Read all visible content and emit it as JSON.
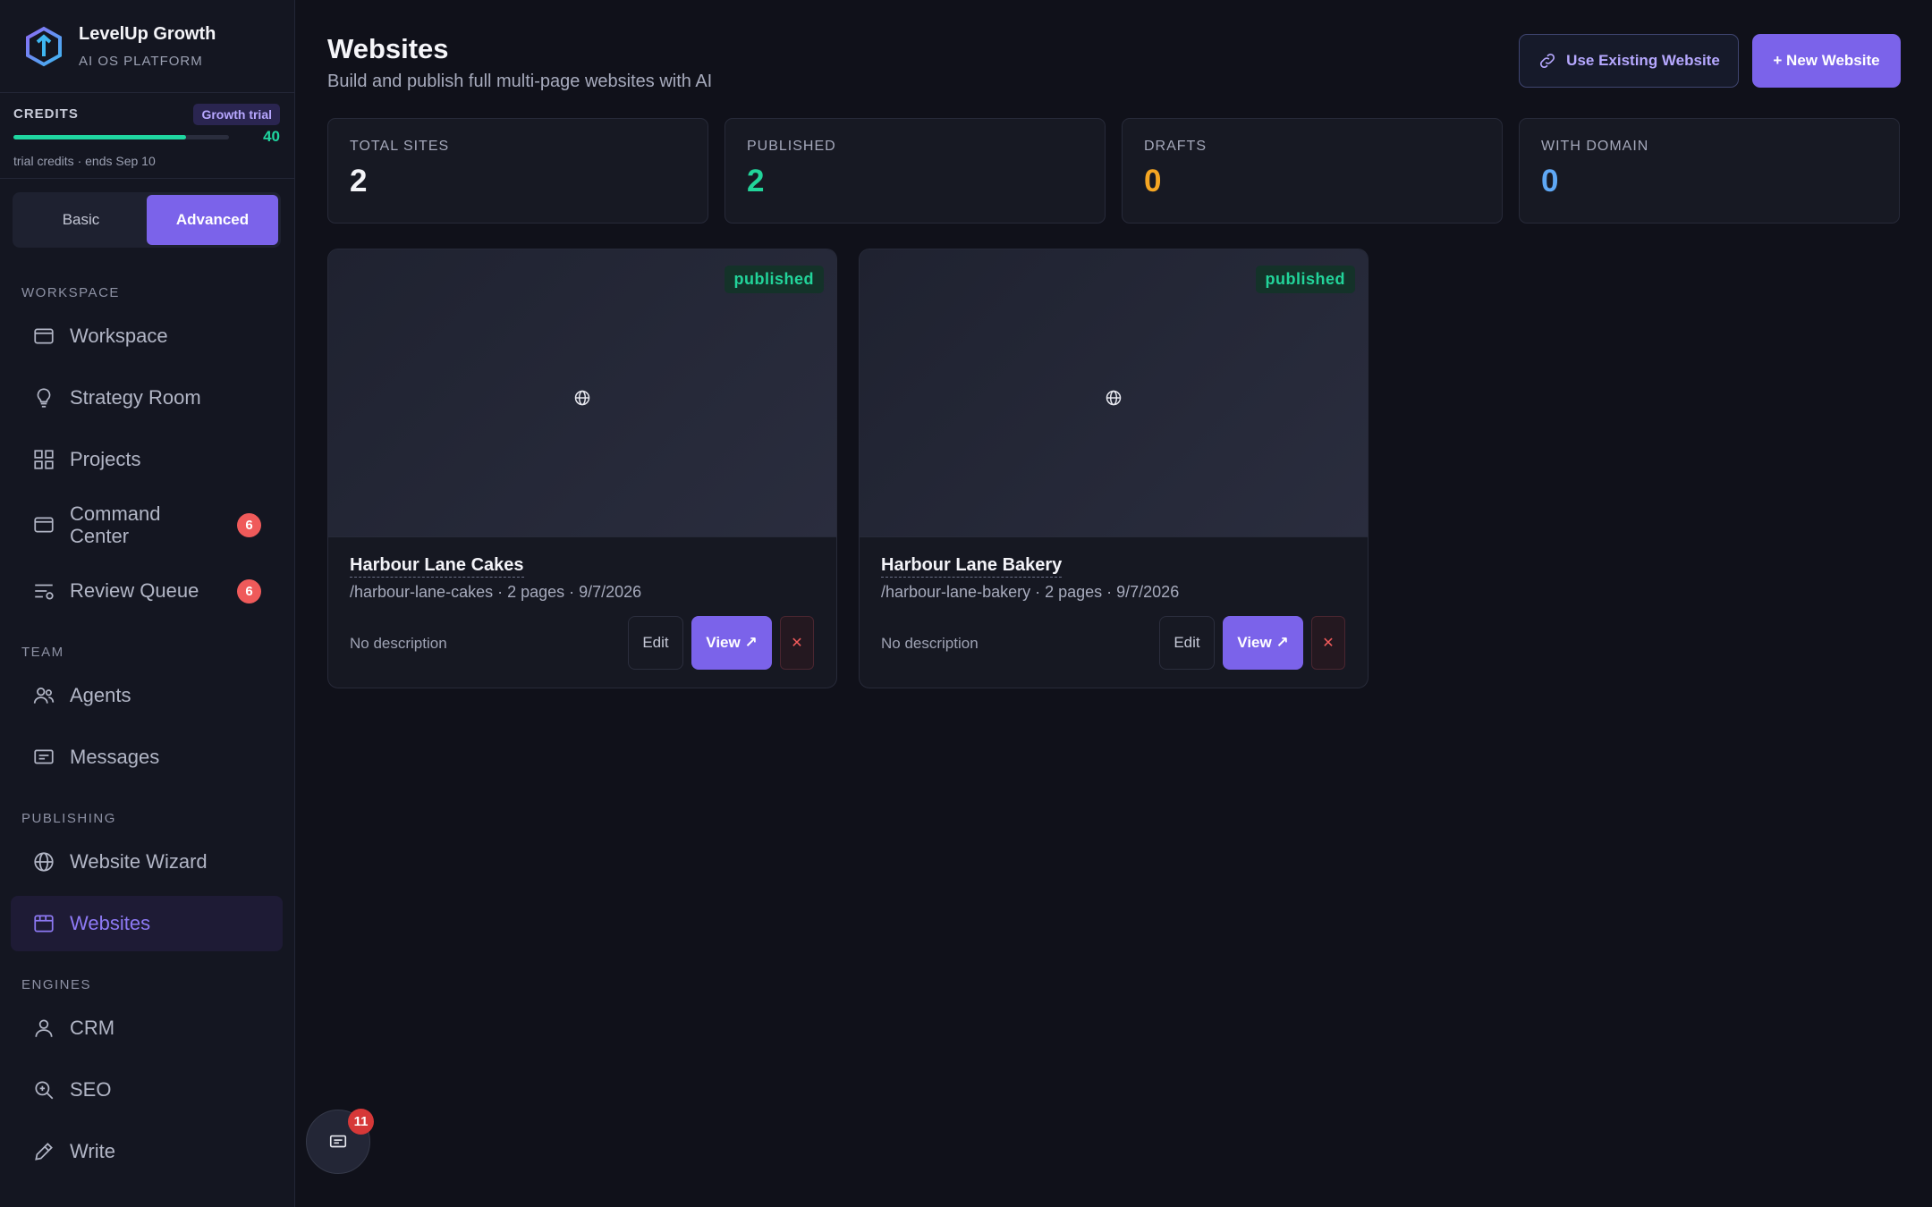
{
  "brand": {
    "name": "LevelUp Growth",
    "subtitle": "AI OS PLATFORM"
  },
  "credits": {
    "title": "CREDITS",
    "badge": "Growth trial",
    "value": "40",
    "fill_fraction": 0.8,
    "note": "trial credits · ends Sep 10"
  },
  "mode": {
    "basic": "Basic",
    "advanced": "Advanced",
    "selected": "Advanced"
  },
  "sidebar": {
    "sections": {
      "workspace": "WORKSPACE",
      "team": "TEAM",
      "publishing": "PUBLISHING",
      "engines": "ENGINES"
    },
    "items": {
      "workspace": "Workspace",
      "strategy": "Strategy Room",
      "projects": "Projects",
      "command_1": "Command",
      "command_2": "Center",
      "command_badge": "6",
      "review": "Review Queue",
      "review_badge": "6",
      "agents": "Agents",
      "messages": "Messages",
      "wizard": "Website Wizard",
      "websites": "Websites",
      "crm": "CRM",
      "seo": "SEO",
      "write": "Write"
    },
    "active": "Websites"
  },
  "header": {
    "title": "Websites",
    "subtitle": "Build and publish full multi-page websites with AI",
    "existing_label": "Use Existing Website",
    "new_label": "+ New Website"
  },
  "stats": [
    {
      "label": "TOTAL SITES",
      "value": "2",
      "color": "#f4f4f8"
    },
    {
      "label": "PUBLISHED",
      "value": "2",
      "color": "#22d49a"
    },
    {
      "label": "DRAFTS",
      "value": "0",
      "color": "#f5a623"
    },
    {
      "label": "WITH DOMAIN",
      "value": "0",
      "color": "#5fa8f5"
    }
  ],
  "sites": [
    {
      "status": "published",
      "title": "Harbour Lane Cakes",
      "meta": "/harbour-lane-cakes · 2 pages · 9/7/2026",
      "description": "No description",
      "edit": "Edit",
      "view": "View ↗",
      "delete": "✕"
    },
    {
      "status": "published",
      "title": "Harbour Lane Bakery",
      "meta": "/harbour-lane-bakery · 2 pages · 9/7/2026",
      "description": "No description",
      "edit": "Edit",
      "view": "View ↗",
      "delete": "✕"
    }
  ],
  "chat": {
    "count": "11"
  },
  "colors": {
    "accent": "#7b63ea",
    "success": "#22d49a",
    "danger": "#ef5a5a"
  }
}
